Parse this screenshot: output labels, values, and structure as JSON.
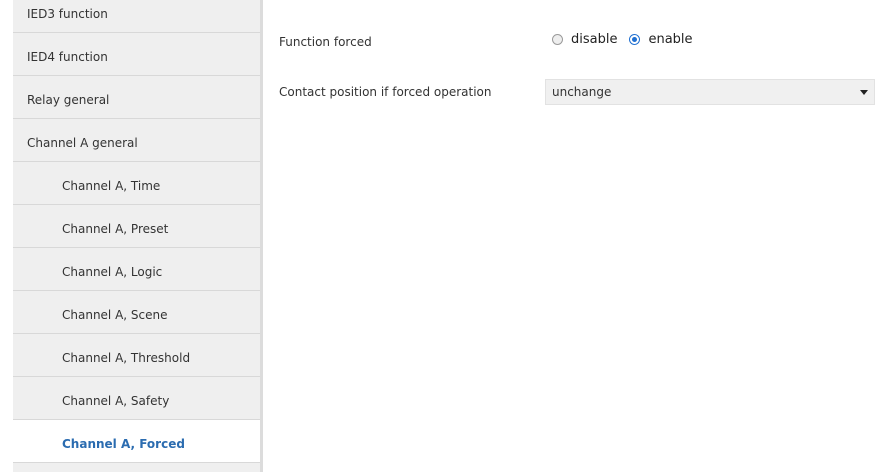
{
  "sidebar": {
    "items": [
      {
        "label": "IED3 function",
        "level": 0,
        "active": false
      },
      {
        "label": "IED4 function",
        "level": 0,
        "active": false
      },
      {
        "label": "Relay general",
        "level": 0,
        "active": false
      },
      {
        "label": "Channel A general",
        "level": 0,
        "active": false
      },
      {
        "label": "Channel A, Time",
        "level": 1,
        "active": false
      },
      {
        "label": "Channel A, Preset",
        "level": 1,
        "active": false
      },
      {
        "label": "Channel A, Logic",
        "level": 1,
        "active": false
      },
      {
        "label": "Channel A, Scene",
        "level": 1,
        "active": false
      },
      {
        "label": "Channel A, Threshold",
        "level": 1,
        "active": false
      },
      {
        "label": "Channel A, Safety",
        "level": 1,
        "active": false
      },
      {
        "label": "Channel A, Forced",
        "level": 1,
        "active": true
      }
    ]
  },
  "main": {
    "function_forced": {
      "label": "Function forced",
      "options": [
        {
          "label": "disable",
          "checked": false
        },
        {
          "label": "enable",
          "checked": true
        }
      ]
    },
    "contact_position": {
      "label": "Contact position if forced operation",
      "value": "unchange"
    }
  },
  "colors": {
    "sidebar_bg": "#efefef",
    "active_text": "#2b6cb0",
    "radio_checked": "#1f6fd1"
  }
}
